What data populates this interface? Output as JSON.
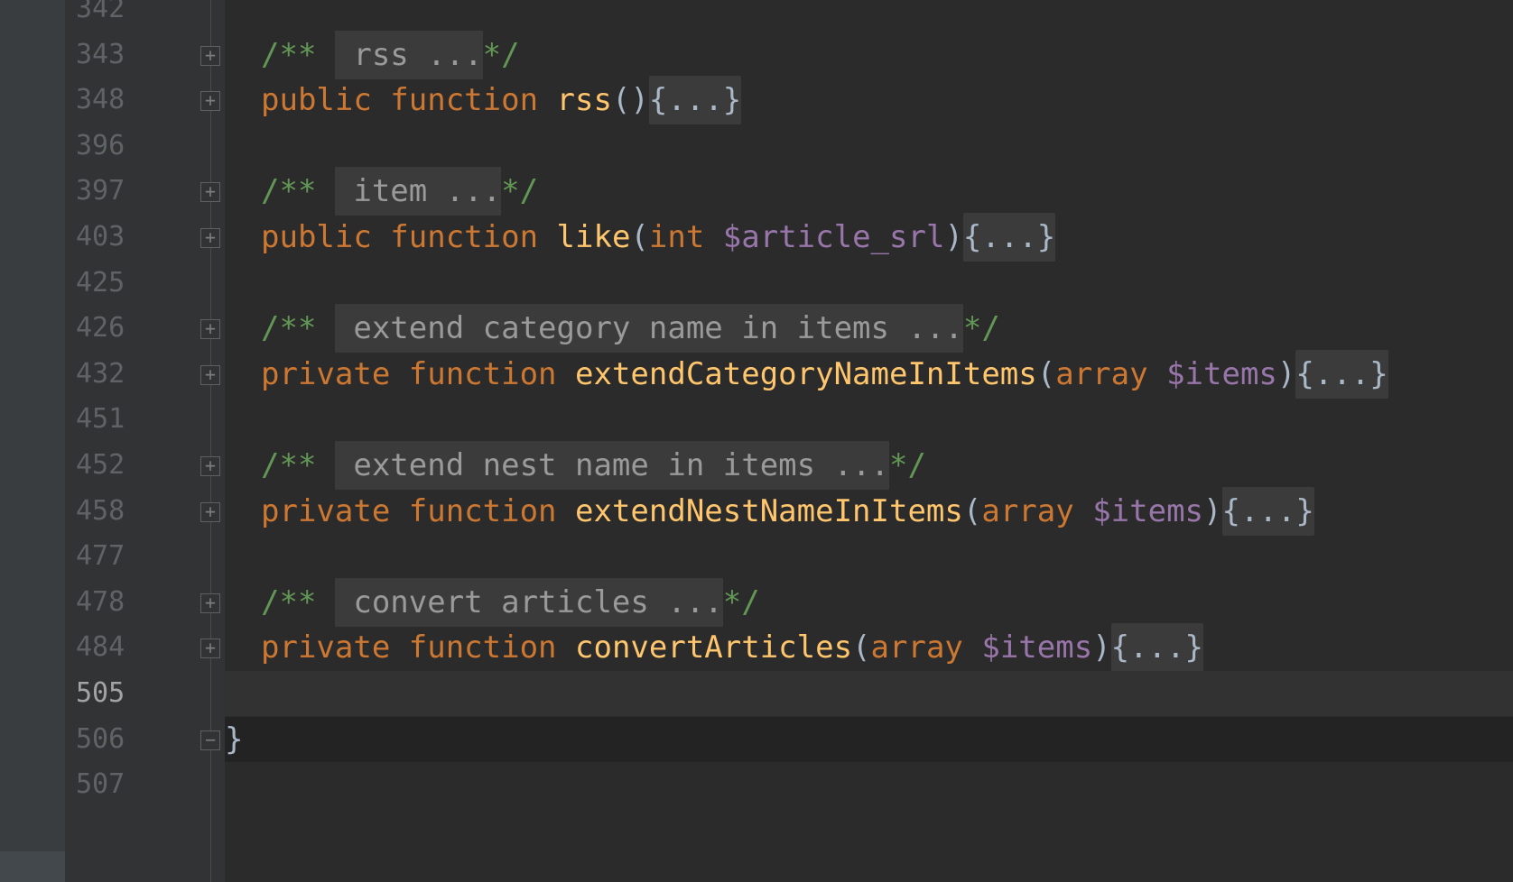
{
  "editor": {
    "lines": [
      {
        "num": "342",
        "fold": "",
        "parts": []
      },
      {
        "num": "343",
        "fold": "plus",
        "parts": [
          {
            "t": "/** ",
            "c": "doc"
          },
          {
            "t": " rss ...",
            "c": "fold-comment"
          },
          {
            "t": "*/",
            "c": "doc"
          }
        ]
      },
      {
        "num": "348",
        "fold": "plus",
        "parts": [
          {
            "t": "public ",
            "c": "kw"
          },
          {
            "t": "function ",
            "c": "kw"
          },
          {
            "t": "rss",
            "c": "fn"
          },
          {
            "t": "()",
            "c": "brk"
          },
          {
            "t": "{...}",
            "c": "fold-text"
          }
        ]
      },
      {
        "num": "396",
        "fold": "",
        "parts": []
      },
      {
        "num": "397",
        "fold": "plus",
        "parts": [
          {
            "t": "/** ",
            "c": "doc"
          },
          {
            "t": " item ...",
            "c": "fold-comment"
          },
          {
            "t": "*/",
            "c": "doc"
          }
        ]
      },
      {
        "num": "403",
        "fold": "plus",
        "parts": [
          {
            "t": "public ",
            "c": "kw"
          },
          {
            "t": "function ",
            "c": "kw"
          },
          {
            "t": "like",
            "c": "fn"
          },
          {
            "t": "(",
            "c": "brk"
          },
          {
            "t": "int ",
            "c": "kw"
          },
          {
            "t": "$article_srl",
            "c": "var"
          },
          {
            "t": ")",
            "c": "brk"
          },
          {
            "t": "{...}",
            "c": "fold-text"
          }
        ]
      },
      {
        "num": "425",
        "fold": "",
        "parts": []
      },
      {
        "num": "426",
        "fold": "plus",
        "parts": [
          {
            "t": "/** ",
            "c": "doc"
          },
          {
            "t": " extend category name in items ...",
            "c": "fold-comment"
          },
          {
            "t": "*/",
            "c": "doc"
          }
        ]
      },
      {
        "num": "432",
        "fold": "plus",
        "parts": [
          {
            "t": "private ",
            "c": "kw"
          },
          {
            "t": "function ",
            "c": "kw"
          },
          {
            "t": "extendCategoryNameInItems",
            "c": "fn"
          },
          {
            "t": "(",
            "c": "brk"
          },
          {
            "t": "array ",
            "c": "kw"
          },
          {
            "t": "$items",
            "c": "var"
          },
          {
            "t": ")",
            "c": "brk"
          },
          {
            "t": "{...}",
            "c": "fold-text"
          }
        ]
      },
      {
        "num": "451",
        "fold": "",
        "parts": []
      },
      {
        "num": "452",
        "fold": "plus",
        "parts": [
          {
            "t": "/** ",
            "c": "doc"
          },
          {
            "t": " extend nest name in items ...",
            "c": "fold-comment"
          },
          {
            "t": "*/",
            "c": "doc"
          }
        ]
      },
      {
        "num": "458",
        "fold": "plus",
        "parts": [
          {
            "t": "private ",
            "c": "kw"
          },
          {
            "t": "function ",
            "c": "kw"
          },
          {
            "t": "extendNestNameInItems",
            "c": "fn"
          },
          {
            "t": "(",
            "c": "brk"
          },
          {
            "t": "array ",
            "c": "kw"
          },
          {
            "t": "$items",
            "c": "var"
          },
          {
            "t": ")",
            "c": "brk"
          },
          {
            "t": "{...}",
            "c": "fold-text"
          }
        ]
      },
      {
        "num": "477",
        "fold": "",
        "parts": []
      },
      {
        "num": "478",
        "fold": "plus",
        "parts": [
          {
            "t": "/** ",
            "c": "doc"
          },
          {
            "t": " convert articles ...",
            "c": "fold-comment"
          },
          {
            "t": "*/",
            "c": "doc"
          }
        ]
      },
      {
        "num": "484",
        "fold": "plus",
        "parts": [
          {
            "t": "private ",
            "c": "kw"
          },
          {
            "t": "function ",
            "c": "kw"
          },
          {
            "t": "convertArticles",
            "c": "fn"
          },
          {
            "t": "(",
            "c": "brk"
          },
          {
            "t": "array ",
            "c": "kw"
          },
          {
            "t": "$items",
            "c": "var"
          },
          {
            "t": ")",
            "c": "brk"
          },
          {
            "t": "{...}",
            "c": "fold-text"
          }
        ]
      },
      {
        "num": "505",
        "fold": "",
        "parts": [],
        "caret": true
      },
      {
        "num": "506",
        "fold": "minus",
        "parts": [
          {
            "t": "}",
            "c": "brk"
          }
        ],
        "closing": true
      },
      {
        "num": "507",
        "fold": "",
        "parts": []
      }
    ],
    "colors": {
      "background": "#2b2b2b",
      "gutter": "#313335",
      "keyword": "#cc7832",
      "function": "#ffc66d",
      "variable": "#9876aa",
      "doc_comment": "#629755",
      "folded_placeholder_bg": "#3b3b3b"
    },
    "icons": {
      "fold_expand": "plus-box-icon",
      "fold_collapse": "minus-box-icon"
    }
  }
}
